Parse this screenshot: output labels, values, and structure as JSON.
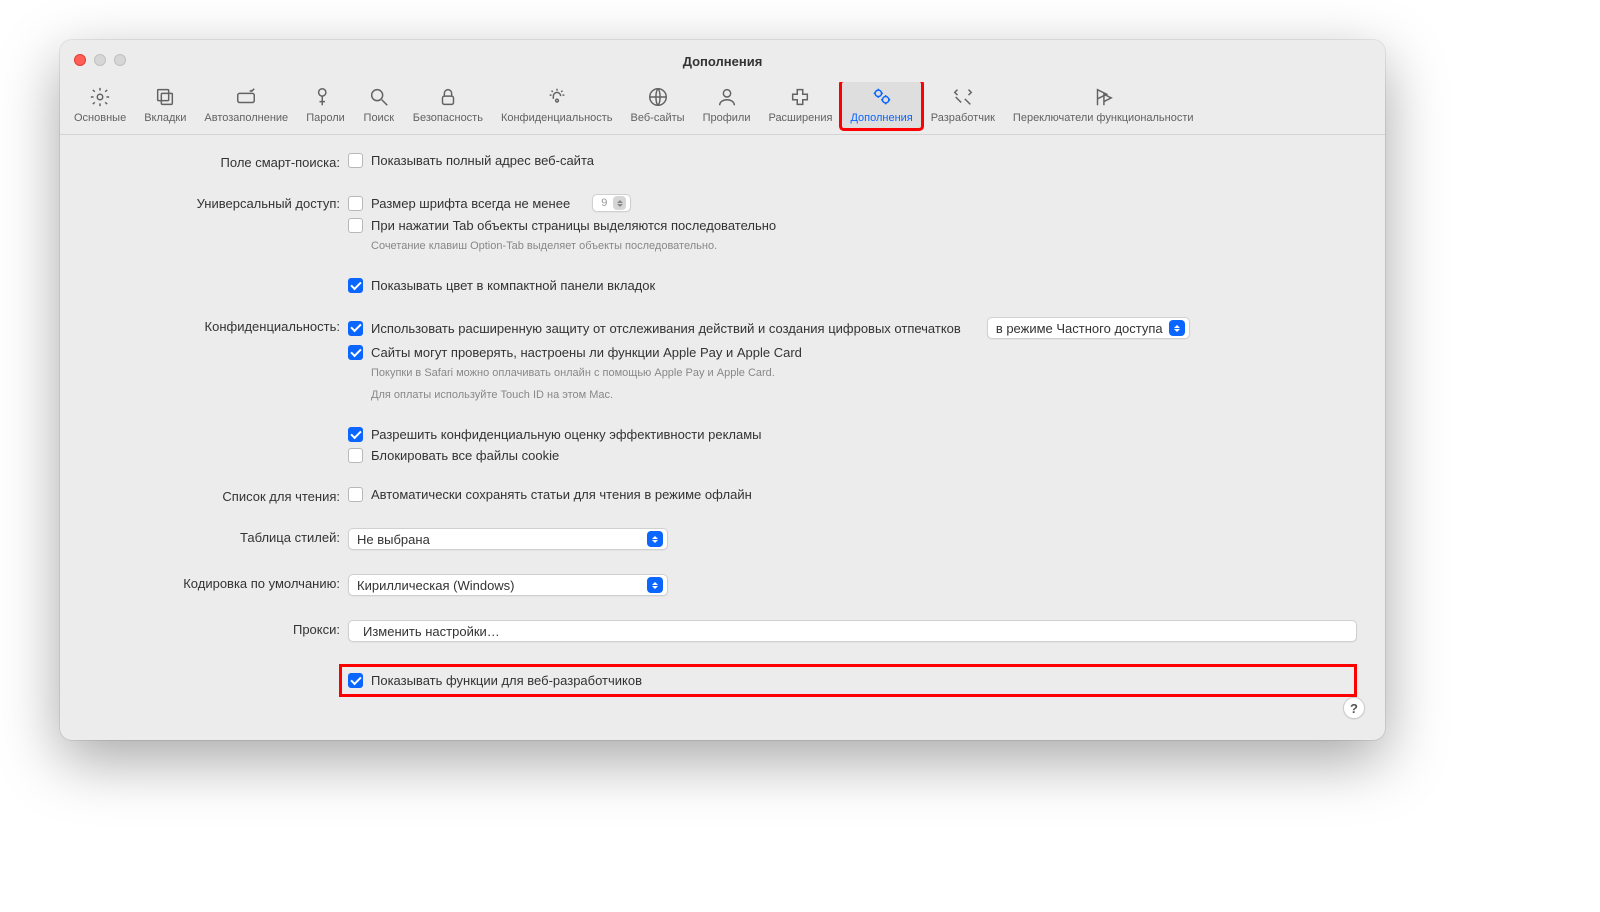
{
  "window_title": "Дополнения",
  "toolbar": [
    {
      "id": "general",
      "label": "Основные"
    },
    {
      "id": "tabs",
      "label": "Вкладки"
    },
    {
      "id": "autofill",
      "label": "Автозаполнение"
    },
    {
      "id": "passwords",
      "label": "Пароли"
    },
    {
      "id": "search",
      "label": "Поиск"
    },
    {
      "id": "security",
      "label": "Безопасность"
    },
    {
      "id": "privacy",
      "label": "Конфиденциальность"
    },
    {
      "id": "websites",
      "label": "Веб-сайты"
    },
    {
      "id": "profiles",
      "label": "Профили"
    },
    {
      "id": "extensions",
      "label": "Расширения"
    },
    {
      "id": "advanced",
      "label": "Дополнения",
      "active": true,
      "highlight": true
    },
    {
      "id": "developer",
      "label": "Разработчик"
    },
    {
      "id": "feature-flags",
      "label": "Переключатели функциональности"
    }
  ],
  "sections": {
    "smart_search": {
      "label": "Поле смарт-поиска:",
      "show_full_url": {
        "checked": false,
        "text": "Показывать полный адрес веб-сайта"
      }
    },
    "accessibility": {
      "label": "Универсальный доступ:",
      "min_font": {
        "checked": false,
        "text": "Размер шрифта всегда не менее",
        "value": "9"
      },
      "tab_highlight": {
        "checked": false,
        "text": "При нажатии Tab объекты страницы выделяются последовательно"
      },
      "tab_note": "Сочетание клавиш Option-Tab выделяет объекты последовательно.",
      "compact_color": {
        "checked": true,
        "text": "Показывать цвет в компактной панели вкладок"
      }
    },
    "privacy": {
      "label": "Конфиденциальность:",
      "tracking": {
        "checked": true,
        "text": "Использовать расширенную защиту от отслеживания действий и создания цифровых отпечатков",
        "mode": "в режиме Частного доступа"
      },
      "applepay": {
        "checked": true,
        "text": "Сайты могут проверять, настроены ли функции Apple Pay и Apple Card"
      },
      "applepay_note1": "Покупки в Safari можно оплачивать онлайн с помощью Apple Pay и Apple Card.",
      "applepay_note2": "Для оплаты используйте Touch ID на этом Mac.",
      "ad_measure": {
        "checked": true,
        "text": "Разрешить конфиденциальную оценку эффективности рекламы"
      },
      "block_cookies": {
        "checked": false,
        "text": "Блокировать все файлы cookie"
      }
    },
    "reading_list": {
      "label": "Список для чтения:",
      "auto_save": {
        "checked": false,
        "text": "Автоматически сохранять статьи для чтения в режиме офлайн"
      }
    },
    "stylesheet": {
      "label": "Таблица стилей:",
      "value": "Не выбрана"
    },
    "encoding": {
      "label": "Кодировка по умолчанию:",
      "value": "Кириллическая (Windows)"
    },
    "proxies": {
      "label": "Прокси:",
      "button": "Изменить настройки…"
    },
    "dev_features": {
      "checked": true,
      "text": "Показывать функции для веб-разработчиков"
    }
  },
  "help": "?"
}
